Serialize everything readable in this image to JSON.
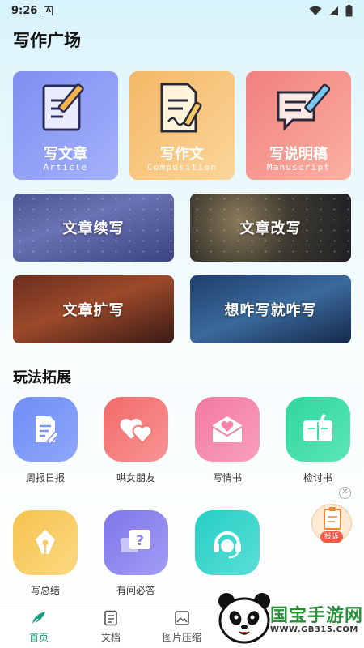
{
  "status_bar": {
    "time": "9:26"
  },
  "header": {
    "title": "写作广场"
  },
  "feature_cards": [
    {
      "title": "写文章",
      "subtitle": "Article"
    },
    {
      "title": "写作文",
      "subtitle": "Composition"
    },
    {
      "title": "写说明稿",
      "subtitle": "Manuscript"
    }
  ],
  "photo_cards": [
    "文章续写",
    "文章改写",
    "文章扩写",
    "想咋写就咋写"
  ],
  "section": {
    "title": "玩法拓展"
  },
  "tools": [
    {
      "label": "周报日报",
      "icon": "document-icon",
      "color": "#7a95f5"
    },
    {
      "label": "哄女朋友",
      "icon": "hearts-icon",
      "color": "#f47878"
    },
    {
      "label": "写情书",
      "icon": "love-letter-icon",
      "color": "#f585a8"
    },
    {
      "label": "检讨书",
      "icon": "notebook-pen-icon",
      "color": "#3fdca4"
    },
    {
      "label": "写总结",
      "icon": "fountain-pen-icon",
      "color": "#f8c95f"
    },
    {
      "label": "有问必答",
      "icon": "question-chat-icon",
      "color": "#8b84ee"
    },
    {
      "label": "",
      "icon": "headset-icon",
      "color": "#36d4ca"
    }
  ],
  "float_widget": {
    "label": "投诉"
  },
  "bottom_nav": [
    {
      "label": "首页",
      "icon": "feather-icon",
      "active": true
    },
    {
      "label": "文档",
      "icon": "doc-list-icon",
      "active": false
    },
    {
      "label": "图片压缩",
      "icon": "image-icon",
      "active": false
    }
  ],
  "watermark": {
    "brand": "国宝手游网",
    "url": "WWW.GB315.COM"
  },
  "colors": {
    "accent": "#1a9e82",
    "background": "#e6f8fb"
  }
}
